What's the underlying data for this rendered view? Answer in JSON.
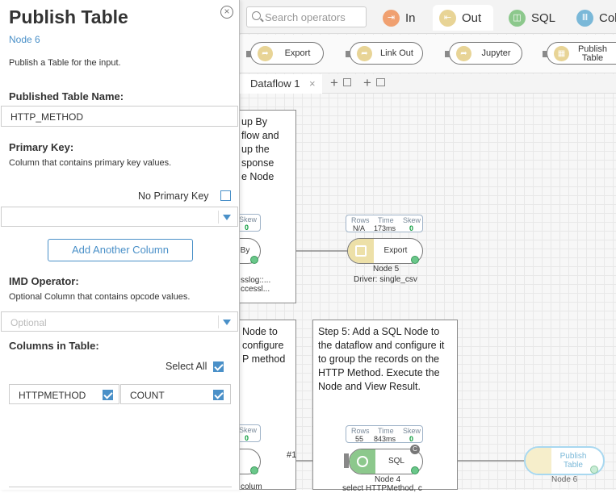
{
  "topbar": {
    "search_placeholder": "Search operators",
    "tabs": [
      {
        "label": "In",
        "color": "#f0a070"
      },
      {
        "label": "Out",
        "color": "#e8d496"
      },
      {
        "label": "SQL",
        "color": "#8cc88c"
      },
      {
        "label": "Col",
        "color": "#7ab8d8"
      }
    ]
  },
  "operators": [
    "Export",
    "Link Out",
    "Jupyter",
    "Publish Table"
  ],
  "dataflow_tab": {
    "label": "Dataflow 1"
  },
  "canvas": {
    "note1_lines": [
      "up By",
      "flow and",
      "up the",
      "sponse",
      "e Node"
    ],
    "note2_lines": [
      "Node to",
      "configure",
      "P method"
    ],
    "note3_text": "Step 5: Add a SQL Node to the dataflow and configure it to group the records on the HTTP Method. Execute the Node and View Result.",
    "node_partial1": {
      "stat_head": "Skew",
      "stat_val": "0",
      "label": "By",
      "sub1": "sslog::...",
      "sub2": "ccessl..."
    },
    "export_node": {
      "rows_h": "Rows",
      "time_h": "Time",
      "skew_h": "Skew",
      "rows": "N/A",
      "time": "173ms",
      "skew": "0",
      "label": "Export",
      "name": "Node 5",
      "desc": "Driver: single_csv"
    },
    "node_partial2": {
      "stat_head": "Skew",
      "stat_val": "0",
      "sub": "colum"
    },
    "sql_node": {
      "rows_h": "Rows",
      "time_h": "Time",
      "skew_h": "Skew",
      "rows": "55",
      "time": "843ms",
      "skew": "0",
      "label": "SQL",
      "name": "Node 4",
      "desc": "select HTTPMethod, c",
      "badge": "C"
    },
    "edge_label": "#1",
    "publish_node": {
      "label": "Publish Table",
      "name": "Node 6"
    }
  },
  "panel": {
    "title": "Publish Table",
    "node": "Node 6",
    "desc": "Publish a Table for the input.",
    "table_name_label": "Published Table Name:",
    "table_name_value": "HTTP_METHOD",
    "pk_label": "Primary Key:",
    "pk_desc": "Column that contains primary key values.",
    "no_pk_label": "No Primary Key",
    "add_col_btn": "Add Another Column",
    "imd_label": "IMD Operator:",
    "imd_desc": "Optional Column that contains opcode values.",
    "imd_placeholder": "Optional",
    "columns_label": "Columns in Table:",
    "select_all": "Select All",
    "columns": [
      "HTTPMETHOD",
      "COUNT"
    ]
  }
}
